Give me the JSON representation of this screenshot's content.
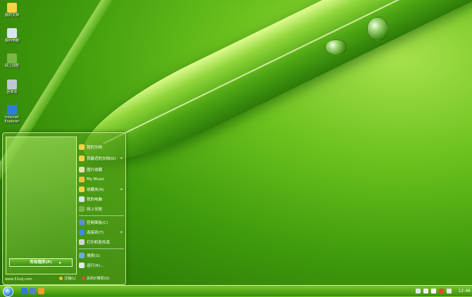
{
  "desktop": {
    "icons": [
      {
        "label": "我的文档",
        "icon": "folder-icon",
        "color": "#f4d248"
      },
      {
        "label": "我的电脑",
        "icon": "computer-icon",
        "color": "#d7e6f0"
      },
      {
        "label": "网上邻居",
        "icon": "network-icon",
        "color": "#7ab648"
      },
      {
        "label": "回收站",
        "icon": "recycle-bin-icon",
        "color": "#bfc8d0"
      },
      {
        "label": "Internet Explorer",
        "icon": "ie-icon",
        "color": "#2c7fd6"
      }
    ]
  },
  "start_menu": {
    "all_programs": "所有程序(P)",
    "website": "www.51zzj.com",
    "items": [
      {
        "label": "我的文档",
        "icon": "folder-icon",
        "color": "#f4d248"
      },
      {
        "label": "我最近的文档(D)",
        "icon": "recent-docs-icon",
        "color": "#f4d248",
        "submenu": true
      },
      {
        "label": "图片收藏",
        "icon": "pictures-icon",
        "color": "#e7e0b0"
      },
      {
        "label": "My Music",
        "icon": "music-icon",
        "color": "#f0c040"
      },
      {
        "label": "收藏夹(A)",
        "icon": "favorites-icon",
        "color": "#f4d248",
        "submenu": true
      },
      {
        "label": "我的电脑",
        "icon": "computer-icon",
        "color": "#d7e6f0"
      },
      {
        "label": "网上邻居",
        "icon": "network-icon",
        "color": "#7ab648"
      },
      {
        "label": "控制面板(C)",
        "icon": "control-panel-icon",
        "color": "#5a8fd0"
      },
      {
        "label": "连接到(T)",
        "icon": "connect-icon",
        "color": "#3c8adc",
        "submenu": true
      },
      {
        "label": "打印机和传真",
        "icon": "printer-icon",
        "color": "#cfd6dc"
      },
      {
        "label": "搜索(S)",
        "icon": "search-icon",
        "color": "#6aa9e6"
      },
      {
        "label": "运行(R)...",
        "icon": "run-icon",
        "color": "#e0e8f0"
      }
    ],
    "logoff": "注销(L)",
    "shutdown": "关闭计算机(U)"
  },
  "taskbar": {
    "clock": "12:46",
    "quick_launch": [
      {
        "icon": "ie-icon",
        "color": "#2c7fd6"
      },
      {
        "icon": "show-desktop-icon",
        "color": "#5b7dc8"
      },
      {
        "icon": "media-player-icon",
        "color": "#f0a030"
      }
    ],
    "tray": [
      {
        "icon": "network-tray-icon",
        "color": "#dfe7ee"
      },
      {
        "icon": "antivirus-tray-icon",
        "color": "#f0f0f0"
      },
      {
        "icon": "volume-tray-icon",
        "color": "#ffffff"
      },
      {
        "icon": "security-tray-icon",
        "color": "#d94c2c"
      },
      {
        "icon": "ime-tray-icon",
        "color": "#e8e8e8"
      }
    ]
  }
}
